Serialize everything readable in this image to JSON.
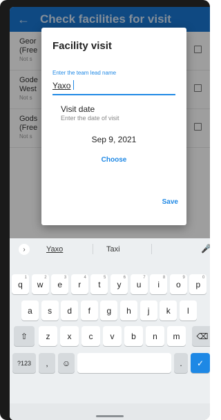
{
  "app_bar": {
    "title": "Check facilities for visit",
    "back_icon": "arrow-left-icon"
  },
  "list": {
    "items": [
      {
        "title": "Geor (Free",
        "subtitle": "Not s"
      },
      {
        "title": "Gode West",
        "subtitle": "Not s"
      },
      {
        "title": "Gods (Free",
        "subtitle": "Not s"
      }
    ]
  },
  "dialog": {
    "title": "Facility visit",
    "lead_field": {
      "label": "Enter the team lead name",
      "value": "Yaxo"
    },
    "visit_date": {
      "label": "Visit date",
      "hint": "Enter the date of visit",
      "value": "Sep 9, 2021",
      "choose_label": "Choose"
    },
    "save_label": "Save"
  },
  "keyboard": {
    "suggestions": [
      "Yaxo",
      "Taxi"
    ],
    "row1": [
      "q",
      "w",
      "e",
      "r",
      "t",
      "y",
      "u",
      "i",
      "o",
      "p"
    ],
    "row1_hints": [
      "1",
      "2",
      "3",
      "4",
      "5",
      "6",
      "7",
      "8",
      "9",
      "0"
    ],
    "row2": [
      "a",
      "s",
      "d",
      "f",
      "g",
      "h",
      "j",
      "k",
      "l"
    ],
    "row3": [
      "z",
      "x",
      "c",
      "v",
      "b",
      "n",
      "m"
    ],
    "symbols_label": "?123",
    "comma_label": ",",
    "period_label": ".",
    "accent": "#1e88e5"
  }
}
